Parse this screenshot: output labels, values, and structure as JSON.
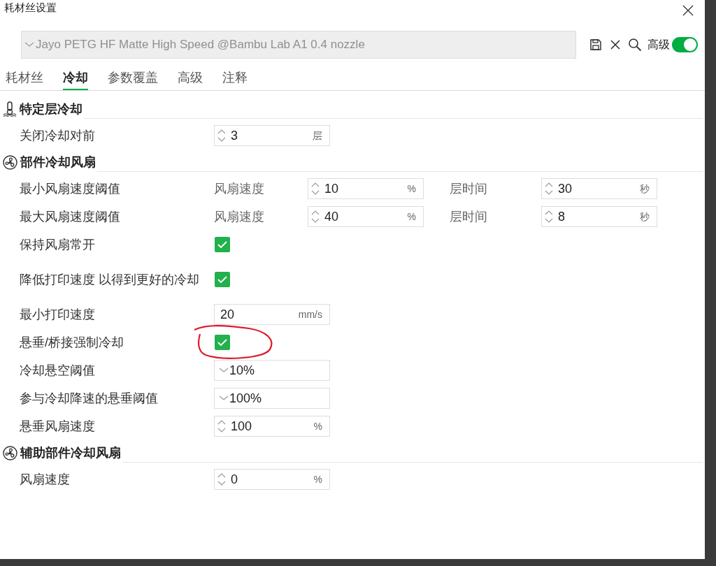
{
  "window": {
    "title": "耗材丝设置"
  },
  "preset": {
    "value": "Jayo PETG HF Matte High Speed @Bambu Lab A1 0.4 nozzle"
  },
  "advanced": {
    "label": "高级",
    "on": true
  },
  "tabs": [
    {
      "label": "耗材丝",
      "selected": false
    },
    {
      "label": "冷却",
      "selected": true
    },
    {
      "label": "参数覆盖",
      "selected": false
    },
    {
      "label": "高级",
      "selected": false
    },
    {
      "label": "注释",
      "selected": false
    }
  ],
  "sections": [
    {
      "title": "特定层冷却",
      "rows": [
        {
          "kind": "spin",
          "label": "关闭冷却对前",
          "value": "3",
          "unit": "层"
        }
      ]
    },
    {
      "title": "部件冷却风扇",
      "rows": [
        {
          "kind": "pair",
          "label": "最小风扇速度阈值",
          "fields": [
            {
              "label": "风扇速度",
              "value": "10",
              "unit": "%"
            },
            {
              "label": "层时间",
              "value": "30",
              "unit": "秒"
            }
          ]
        },
        {
          "kind": "pair",
          "label": "最大风扇速度阈值",
          "fields": [
            {
              "label": "风扇速度",
              "value": "40",
              "unit": "%"
            },
            {
              "label": "层时间",
              "value": "8",
              "unit": "秒"
            }
          ]
        },
        {
          "kind": "checkbox",
          "label": "保持风扇常开",
          "checked": true,
          "annotated": false
        },
        {
          "kind": "checkbox",
          "label": "降低打印速度 以得到更好的冷却",
          "checked": true,
          "annotated": false
        },
        {
          "kind": "text",
          "label": "最小打印速度",
          "value": "20",
          "unit": "mm/s"
        },
        {
          "kind": "checkbox",
          "label": "悬垂/桥接强制冷却",
          "checked": true,
          "annotated": true
        },
        {
          "kind": "combo",
          "label": "冷却悬空阈值",
          "value": "10%"
        },
        {
          "kind": "combo",
          "label": "参与冷却降速的悬垂阈值",
          "value": "100%"
        },
        {
          "kind": "spin",
          "label": "悬垂风扇速度",
          "value": "100",
          "unit": "%"
        }
      ]
    },
    {
      "title": "辅助部件冷却风扇",
      "rows": [
        {
          "kind": "spin",
          "label": "风扇速度",
          "value": "0",
          "unit": "%"
        }
      ]
    }
  ]
}
